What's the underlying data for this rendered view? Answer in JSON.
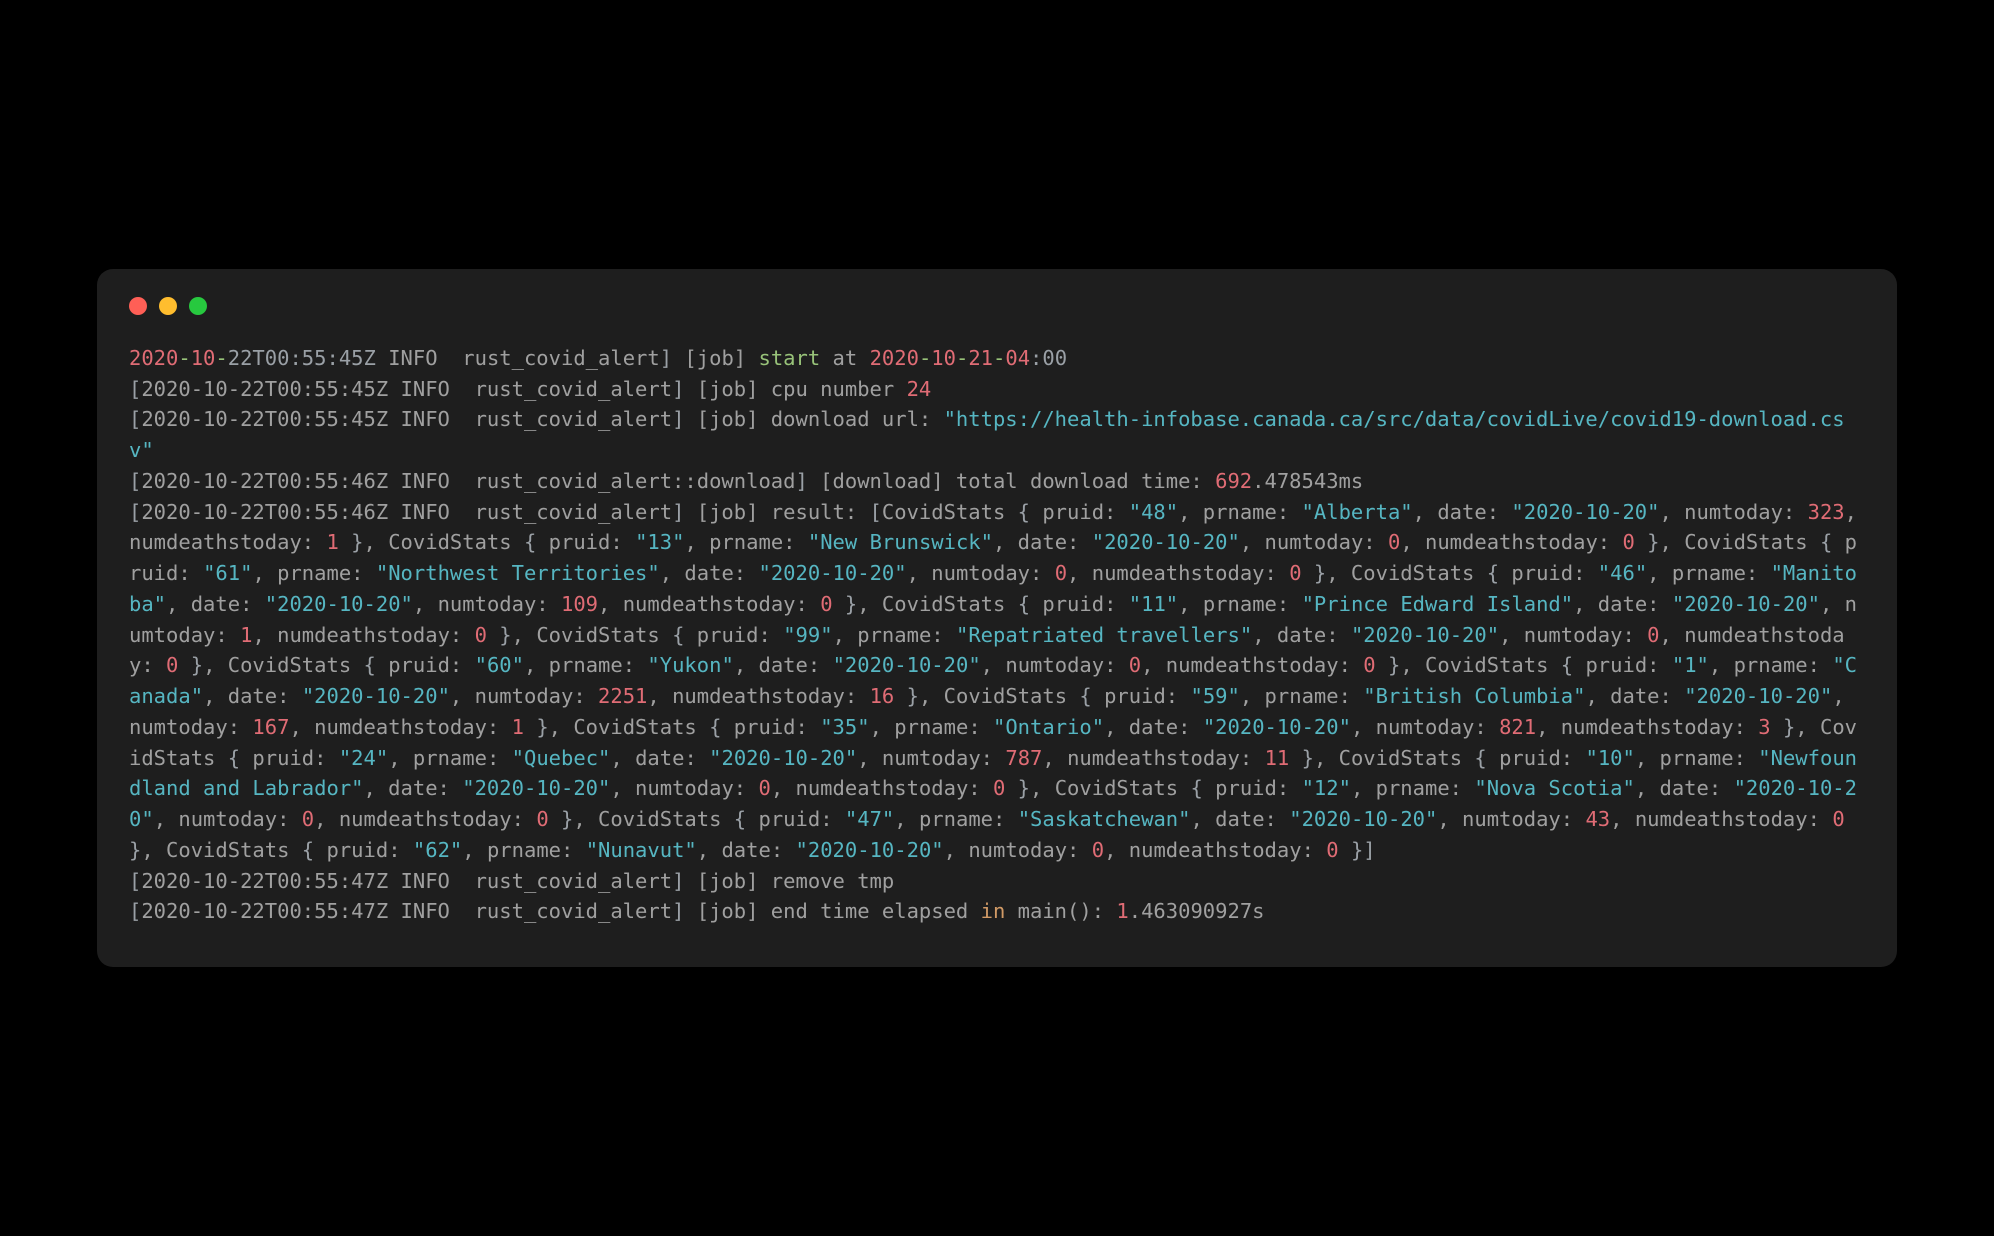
{
  "colors": {
    "red": "#e06c75",
    "green": "#98c379",
    "cyan": "#56b6c2",
    "yellow": "#d19a66",
    "gray": "#9aa0a6"
  },
  "timestamps": {
    "t1": "2020-10-22T00:55:45Z",
    "t2": "2020-10-22T00:55:46Z",
    "t3": "2020-10-22T00:55:47Z"
  },
  "labels": {
    "info": "INFO",
    "module_main": "rust_covid_alert",
    "module_download": "rust_covid_alert::download",
    "job_tag": "[job]",
    "download_tag": "[download]",
    "start_word": "start",
    "at_word": "at",
    "start_time": "2020-10-21-04",
    "start_time_tail": ":00",
    "cpu_text": "cpu number ",
    "cpu_num": "24",
    "download_url_label": "download url: ",
    "download_url": "\"https://health-infobase.canada.ca/src/data/covidLive/covid19-download.csv\"",
    "total_download_time": "total download time: ",
    "download_time_num": "692",
    "download_time_tail": ".478543ms",
    "result_label": "result: ",
    "remove_tmp": "remove tmp",
    "end_time_label": "end time elapsed ",
    "in_word": "in",
    "main_tail": " main(): ",
    "elapsed_num": "1",
    "elapsed_tail": ".463090927s",
    "head_year": "2020",
    "head_date_rest": "-10-22T00:55:45Z"
  },
  "covid_stats": [
    {
      "pruid": "48",
      "prname": "Alberta",
      "date": "2020-10-20",
      "numtoday": 323,
      "numdeathstoday": 1
    },
    {
      "pruid": "13",
      "prname": "New Brunswick",
      "date": "2020-10-20",
      "numtoday": 0,
      "numdeathstoday": 0
    },
    {
      "pruid": "61",
      "prname": "Northwest Territories",
      "date": "2020-10-20",
      "numtoday": 0,
      "numdeathstoday": 0
    },
    {
      "pruid": "46",
      "prname": "Manitoba",
      "date": "2020-10-20",
      "numtoday": 109,
      "numdeathstoday": 0
    },
    {
      "pruid": "11",
      "prname": "Prince Edward Island",
      "date": "2020-10-20",
      "numtoday": 1,
      "numdeathstoday": 0
    },
    {
      "pruid": "99",
      "prname": "Repatriated travellers",
      "date": "2020-10-20",
      "numtoday": 0,
      "numdeathstoday": 0
    },
    {
      "pruid": "60",
      "prname": "Yukon",
      "date": "2020-10-20",
      "numtoday": 0,
      "numdeathstoday": 0
    },
    {
      "pruid": "1",
      "prname": "Canada",
      "date": "2020-10-20",
      "numtoday": 2251,
      "numdeathstoday": 16
    },
    {
      "pruid": "59",
      "prname": "British Columbia",
      "date": "2020-10-20",
      "numtoday": 167,
      "numdeathstoday": 1
    },
    {
      "pruid": "35",
      "prname": "Ontario",
      "date": "2020-10-20",
      "numtoday": 821,
      "numdeathstoday": 3
    },
    {
      "pruid": "24",
      "prname": "Quebec",
      "date": "2020-10-20",
      "numtoday": 787,
      "numdeathstoday": 11
    },
    {
      "pruid": "10",
      "prname": "Newfoundland and Labrador",
      "date": "2020-10-20",
      "numtoday": 0,
      "numdeathstoday": 0
    },
    {
      "pruid": "12",
      "prname": "Nova Scotia",
      "date": "2020-10-20",
      "numtoday": 0,
      "numdeathstoday": 0
    },
    {
      "pruid": "47",
      "prname": "Saskatchewan",
      "date": "2020-10-20",
      "numtoday": 43,
      "numdeathstoday": 0
    },
    {
      "pruid": "62",
      "prname": "Nunavut",
      "date": "2020-10-20",
      "numtoday": 0,
      "numdeathstoday": 0
    }
  ]
}
